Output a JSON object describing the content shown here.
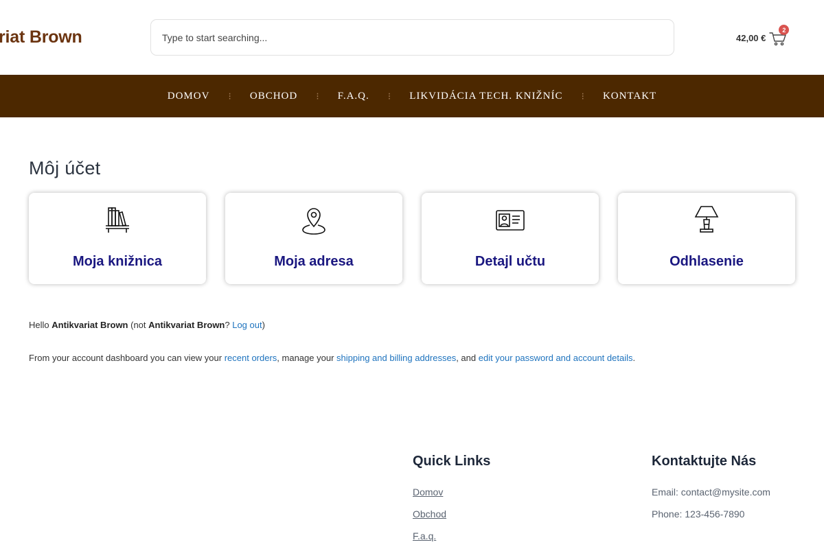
{
  "header": {
    "logo": "riat Brown",
    "search_placeholder": "Type to start searching...",
    "cart_total": "42,00 €",
    "cart_count": "2"
  },
  "nav": {
    "items": [
      {
        "label": "DOMOV"
      },
      {
        "label": "OBCHOD"
      },
      {
        "label": "F.A.Q."
      },
      {
        "label": "LIKVIDÁCIA TECH. KNIŽNÍC"
      },
      {
        "label": "KONTAKT"
      }
    ],
    "separator": "⁝"
  },
  "page": {
    "title": "Môj účet",
    "cards": [
      {
        "label": "Moja knižnica",
        "icon": "bookshelf-icon"
      },
      {
        "label": "Moja adresa",
        "icon": "location-pin-icon"
      },
      {
        "label": "Detajl učtu",
        "icon": "id-card-icon"
      },
      {
        "label": "Odhlasenie",
        "icon": "lamp-icon"
      }
    ],
    "hello": {
      "prefix": "Hello ",
      "username": "Antikvariat Brown",
      "mid": " (not ",
      "username2": "Antikvariat Brown",
      "q": "? ",
      "logout": "Log out",
      "close": ")"
    },
    "dashboard": {
      "t1": "From your account dashboard you can view your ",
      "l1": "recent orders",
      "t2": ", manage your ",
      "l2": "shipping and billing addresses",
      "t3": ", and ",
      "l3": "edit your password and account details",
      "t4": "."
    }
  },
  "footer": {
    "quick_links": {
      "title": "Quick Links",
      "items": [
        "Domov",
        "Obchod",
        "F.a.q."
      ]
    },
    "contact": {
      "title": "Kontaktujte Nás",
      "email": "Email: contact@mysite.com",
      "phone": "Phone: 123-456-7890"
    }
  },
  "colors": {
    "brand": "#6b3410",
    "nav_bg": "#4c2800",
    "card_label": "#1a1780",
    "link": "#1e73be",
    "badge": "#d9534f"
  }
}
